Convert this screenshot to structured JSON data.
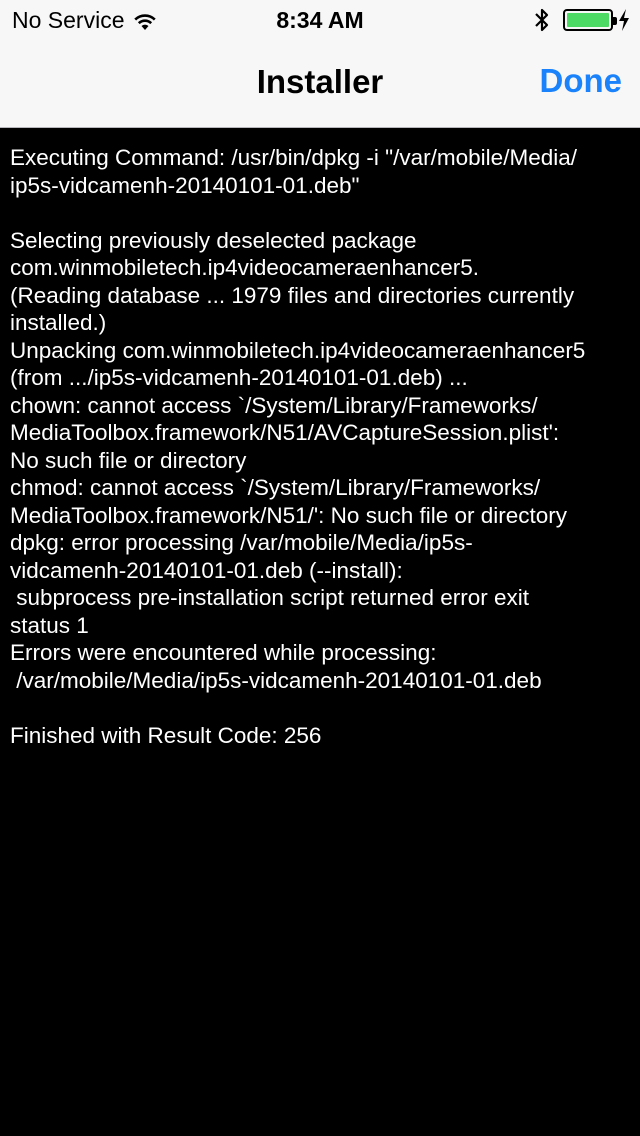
{
  "status_bar": {
    "carrier": "No Service",
    "time": "8:34 AM",
    "battery_level": 1.0,
    "battery_color": "#4cd964"
  },
  "nav": {
    "title": "Installer",
    "done_label": "Done",
    "accent_color": "#1a82fb"
  },
  "console": {
    "output": "Executing Command: /usr/bin/dpkg -i \"/var/mobile/Media/\nip5s-vidcamenh-20140101-01.deb\"\n\nSelecting previously deselected package\ncom.winmobiletech.ip4videocameraenhancer5.\n(Reading database ... 1979 files and directories currently\ninstalled.)\nUnpacking com.winmobiletech.ip4videocameraenhancer5\n(from .../ip5s-vidcamenh-20140101-01.deb) ...\nchown: cannot access `/System/Library/Frameworks/\nMediaToolbox.framework/N51/AVCaptureSession.plist':\nNo such file or directory\nchmod: cannot access `/System/Library/Frameworks/\nMediaToolbox.framework/N51/': No such file or directory\ndpkg: error processing /var/mobile/Media/ip5s-\nvidcamenh-20140101-01.deb (--install):\n subprocess pre-installation script returned error exit\nstatus 1\nErrors were encountered while processing:\n /var/mobile/Media/ip5s-vidcamenh-20140101-01.deb\n\nFinished with Result Code: 256"
  }
}
